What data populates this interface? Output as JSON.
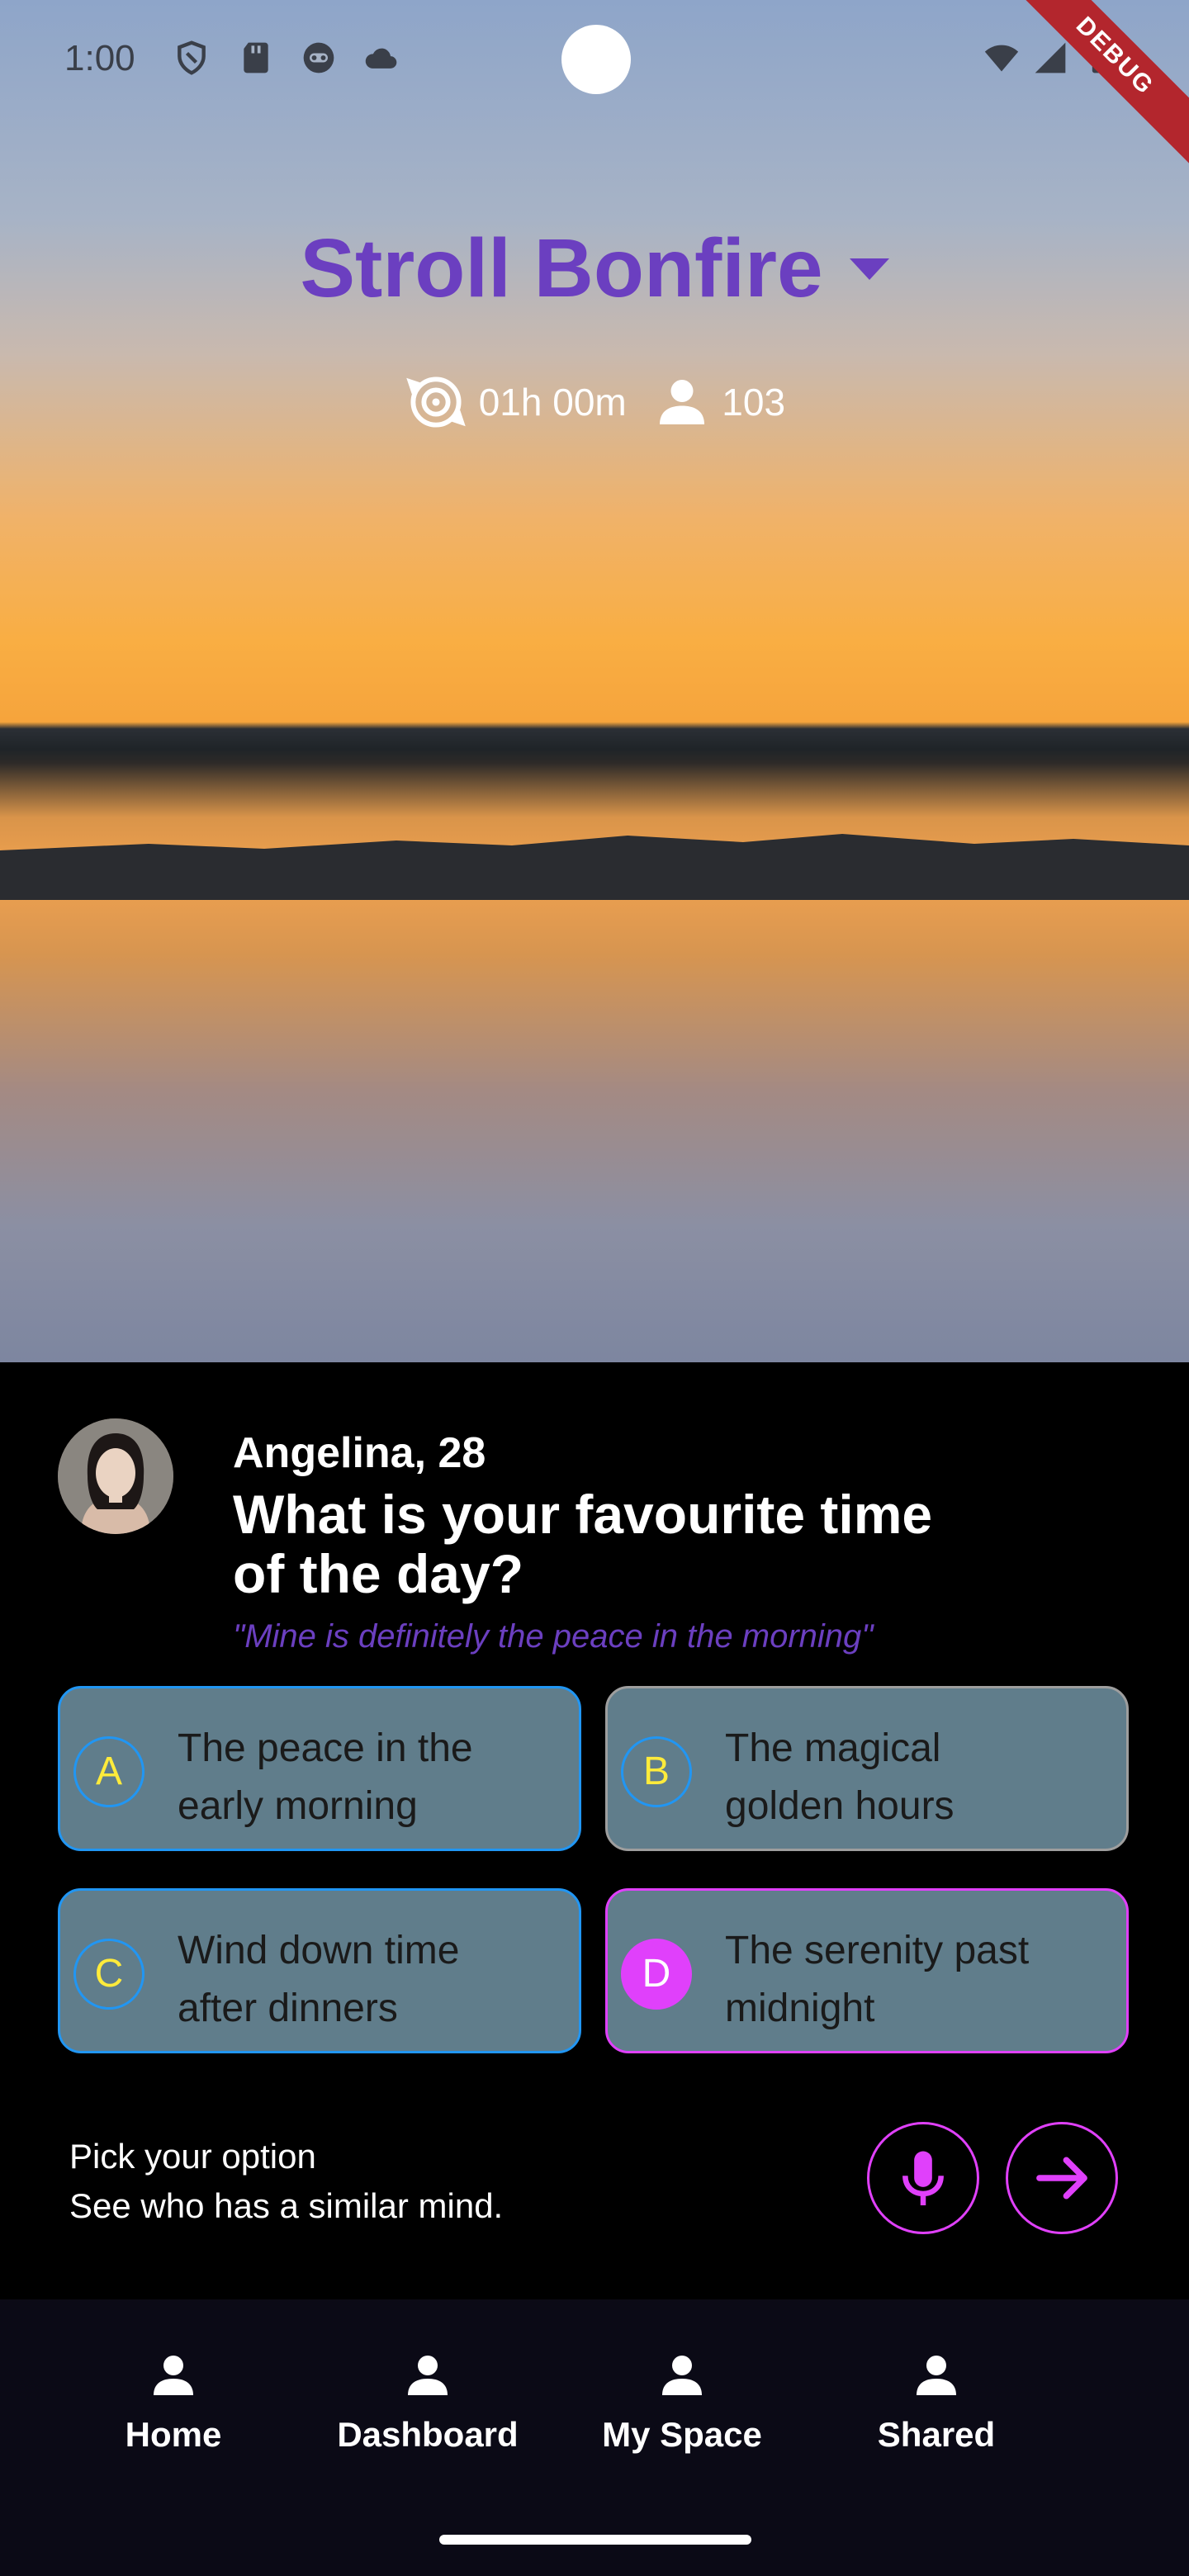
{
  "status_bar": {
    "time": "1:00",
    "debug_banner": "DEBUG"
  },
  "header": {
    "title": "Stroll Bonfire",
    "duration": "01h 00m",
    "participants": "103"
  },
  "question_card": {
    "asker": "Angelina, 28",
    "question": "What is your favourite time\n of the day?",
    "quote": "\"Mine is definitely the peace in the morning\""
  },
  "options": [
    {
      "letter": "A",
      "text": "The peace in the\n early morning"
    },
    {
      "letter": "B",
      "text": "The magical\n golden hours"
    },
    {
      "letter": "C",
      "text": "Wind down time\n after dinners"
    },
    {
      "letter": "D",
      "text": "The serenity past\n midnight",
      "selected": true
    }
  ],
  "footer_hint": {
    "line1": "Pick your option",
    "line2": "See who has a similar mind."
  },
  "bottom_nav": [
    {
      "label": "Home",
      "icon": "person-icon"
    },
    {
      "label": "Dashboard",
      "icon": "person-icon"
    },
    {
      "label": "My Space",
      "icon": "person-icon"
    },
    {
      "label": "Shared",
      "icon": "person-icon"
    }
  ],
  "colors": {
    "accent_purple": "#6b3fc0",
    "magenta": "#e040fb",
    "blue": "#2196f3",
    "option_bg": "#607d8b",
    "badge_yellow": "#ffeb3b"
  }
}
